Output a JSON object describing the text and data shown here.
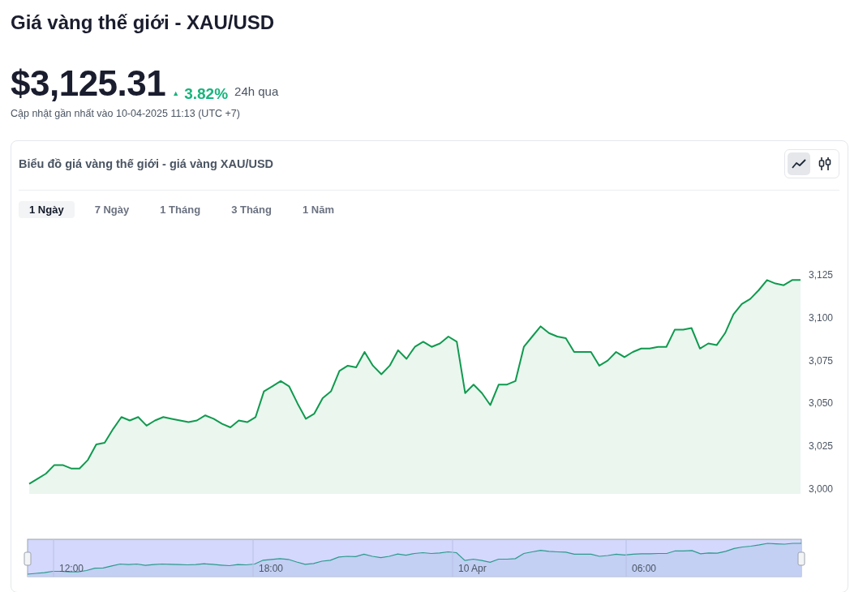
{
  "page_title": "Giá vàng thế giới - XAU/USD",
  "price": {
    "value": "$3,125.31",
    "arrow": "▲",
    "change": "3.82%",
    "period": "24h qua",
    "updated": "Cập nhật gần nhất vào 10-04-2025 11:13 (UTC +7)"
  },
  "chart_card": {
    "title": "Biểu đồ giá vàng thế giới - giá vàng XAU/USD",
    "chart_types": [
      {
        "kind": "line",
        "selected": true
      },
      {
        "kind": "candlestick",
        "selected": false
      }
    ],
    "range_tabs": [
      {
        "label": "1 Ngày",
        "selected": true
      },
      {
        "label": "7 Ngày",
        "selected": false
      },
      {
        "label": "1 Tháng",
        "selected": false
      },
      {
        "label": "3 Tháng",
        "selected": false
      },
      {
        "label": "1 Năm",
        "selected": false
      }
    ],
    "chart_data": {
      "type": "area",
      "ylim": [
        3000,
        3125
      ],
      "yticks": [
        {
          "value": 3000,
          "label": "3,000"
        },
        {
          "value": 3025,
          "label": "3,025"
        },
        {
          "value": 3050,
          "label": "3,050"
        },
        {
          "value": 3075,
          "label": "3,075"
        },
        {
          "value": 3100,
          "label": "3,100"
        },
        {
          "value": 3125,
          "label": "3,125"
        }
      ],
      "categories": [
        null,
        null,
        null,
        null,
        null,
        null,
        null,
        null,
        null,
        null,
        null,
        null,
        null,
        null,
        null,
        null,
        null,
        null,
        null,
        null,
        null,
        null,
        null,
        null,
        null,
        null,
        null,
        null,
        null,
        null,
        null,
        null,
        null,
        null,
        null,
        null,
        null,
        null,
        null,
        null,
        null,
        null,
        null,
        null,
        null,
        null,
        null,
        null,
        null,
        null,
        null,
        null,
        null,
        null,
        null,
        null,
        null,
        null,
        null,
        null,
        null,
        null,
        null,
        null,
        null,
        null,
        null,
        null,
        null,
        null,
        null,
        null,
        null,
        null,
        null,
        null,
        null,
        null,
        null,
        null,
        null,
        null,
        null,
        null,
        null,
        null,
        null,
        null,
        null,
        null,
        null,
        null,
        null
      ],
      "series": [
        {
          "color": "#0f9a4e",
          "values": [
            3003,
            3006,
            3009,
            3014,
            3014,
            3012,
            3012,
            3017,
            3026,
            3027,
            3035,
            3042,
            3040,
            3042,
            3037,
            3040,
            3042,
            3041,
            3040,
            3039,
            3040,
            3043,
            3041,
            3038,
            3036,
            3040,
            3039,
            3042,
            3057,
            3060,
            3063,
            3060,
            3050,
            3041,
            3044,
            3053,
            3057,
            3069,
            3072,
            3071,
            3080,
            3072,
            3067,
            3072,
            3081,
            3076,
            3083,
            3086,
            3083,
            3085,
            3089,
            3086,
            3056,
            3061,
            3056,
            3049,
            3061,
            3061,
            3063,
            3083,
            3089,
            3095,
            3091,
            3089,
            3088,
            3080,
            3080,
            3080,
            3072,
            3075,
            3080,
            3077,
            3080,
            3082,
            3082,
            3083,
            3083,
            3093,
            3093,
            3094,
            3082,
            3085,
            3084,
            3091,
            3102,
            3108,
            3111,
            3116,
            3122,
            3120,
            3119,
            3122,
            3122
          ]
        }
      ]
    },
    "navigator": {
      "labels": [
        "12:00",
        "18:00",
        "10 Apr",
        "06:00"
      ]
    }
  }
}
